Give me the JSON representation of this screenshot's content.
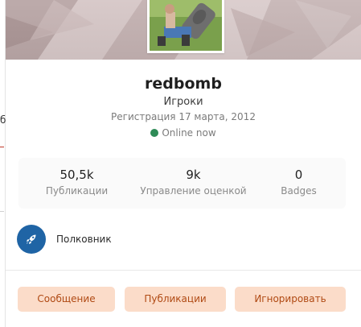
{
  "profile": {
    "username": "redbomb",
    "group": "Игроки",
    "joined": "Регистрация 17 марта, 2012",
    "status": "Online now"
  },
  "stats": [
    {
      "value": "50,5k",
      "label": "Публикации"
    },
    {
      "value": "9k",
      "label": "Управление оценкой"
    },
    {
      "value": "0",
      "label": "Badges"
    }
  ],
  "rank": {
    "label": "Полковник",
    "icon": "rocket-icon"
  },
  "actions": {
    "message": "Сообщение",
    "posts": "Публикации",
    "ignore": "Игнорировать"
  },
  "background_page": {
    "edge_text": "б"
  },
  "colors": {
    "online": "#2e8b57",
    "rank_badge": "#1f64a5",
    "button_bg": "#fbdcc9",
    "button_text": "#b04a14"
  }
}
